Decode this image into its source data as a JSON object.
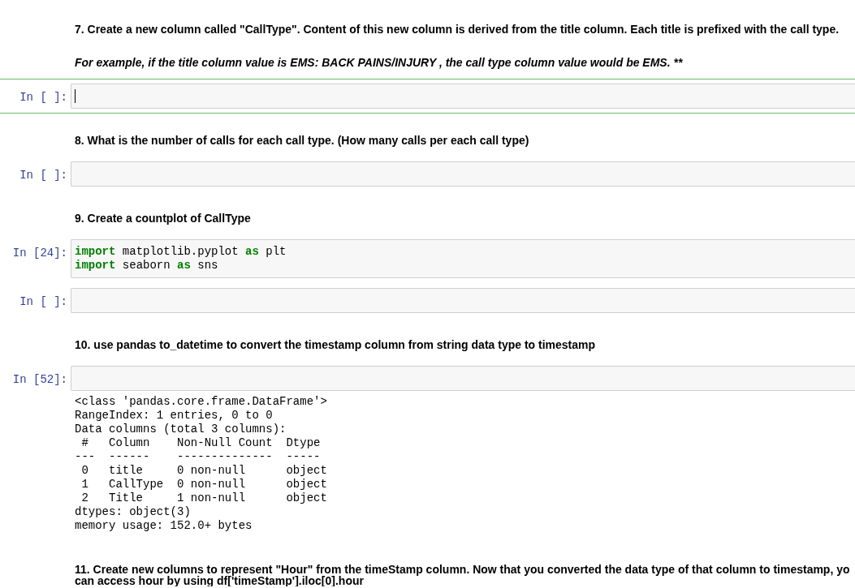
{
  "cells": [
    {
      "kind": "markdown",
      "selected": false,
      "paragraphs": [
        {
          "kind": "plain",
          "lines": [
            "7. Create a new column called \"CallType\". Content of this new column is derived from the title column. Each title is prefixed with the call type."
          ]
        },
        {
          "kind": "emphasis",
          "lines": [
            "For example, if the title column value is EMS: BACK PAINS/INJURY , the call type column value would be EMS. **"
          ]
        }
      ]
    },
    {
      "kind": "code",
      "selected": true,
      "editing": true,
      "prompt": "In [ ]:"
    },
    {
      "kind": "markdown",
      "selected": false,
      "paragraphs": [
        {
          "kind": "plain",
          "lines": [
            "8. What is the number of calls for each call type. (How many calls per each call type)"
          ]
        }
      ]
    },
    {
      "kind": "code",
      "selected": false,
      "editing": false,
      "prompt": "In [ ]:"
    },
    {
      "kind": "markdown",
      "selected": false,
      "paragraphs": [
        {
          "kind": "plain",
          "lines": [
            "9. Create a countplot of CallType"
          ]
        }
      ]
    },
    {
      "kind": "code",
      "selected": false,
      "editing": false,
      "prompt": "In [24]:",
      "code": [
        [
          {
            "kind": "keyword",
            "text": "import"
          },
          {
            "kind": "plain",
            "text": " matplotlib.pyplot "
          },
          {
            "kind": "keyword",
            "text": "as"
          },
          {
            "kind": "plain",
            "text": " plt"
          }
        ],
        [
          {
            "kind": "keyword",
            "text": "import"
          },
          {
            "kind": "plain",
            "text": " seaborn "
          },
          {
            "kind": "keyword",
            "text": "as"
          },
          {
            "kind": "plain",
            "text": " sns"
          }
        ]
      ]
    },
    {
      "kind": "code",
      "selected": false,
      "editing": false,
      "prompt": "In [ ]:"
    },
    {
      "kind": "markdown",
      "selected": false,
      "paragraphs": [
        {
          "kind": "plain",
          "lines": [
            "10. use pandas to_datetime to convert the timestamp column from string data type to timestamp"
          ]
        }
      ]
    },
    {
      "kind": "code",
      "selected": false,
      "editing": false,
      "prompt": "In [52]:",
      "output": [
        "<class 'pandas.core.frame.DataFrame'>",
        "RangeIndex: 1 entries, 0 to 0",
        "Data columns (total 3 columns):",
        " #   Column    Non-Null Count  Dtype",
        "---  ------    --------------  -----",
        " 0   title     0 non-null      object",
        " 1   CallType  0 non-null      object",
        " 2   Title     1 non-null      object",
        "dtypes: object(3)",
        "memory usage: 152.0+ bytes"
      ]
    },
    {
      "kind": "markdown",
      "selected": false,
      "paragraphs": [
        {
          "kind": "plain",
          "lines": [
            "11. Create new columns to represent \"Hour\" from the timeStamp column. Now that you converted the data type of that column to timestamp, yo",
            "can access hour by using df['timeStamp'].iloc[0].hour"
          ]
        }
      ]
    }
  ]
}
